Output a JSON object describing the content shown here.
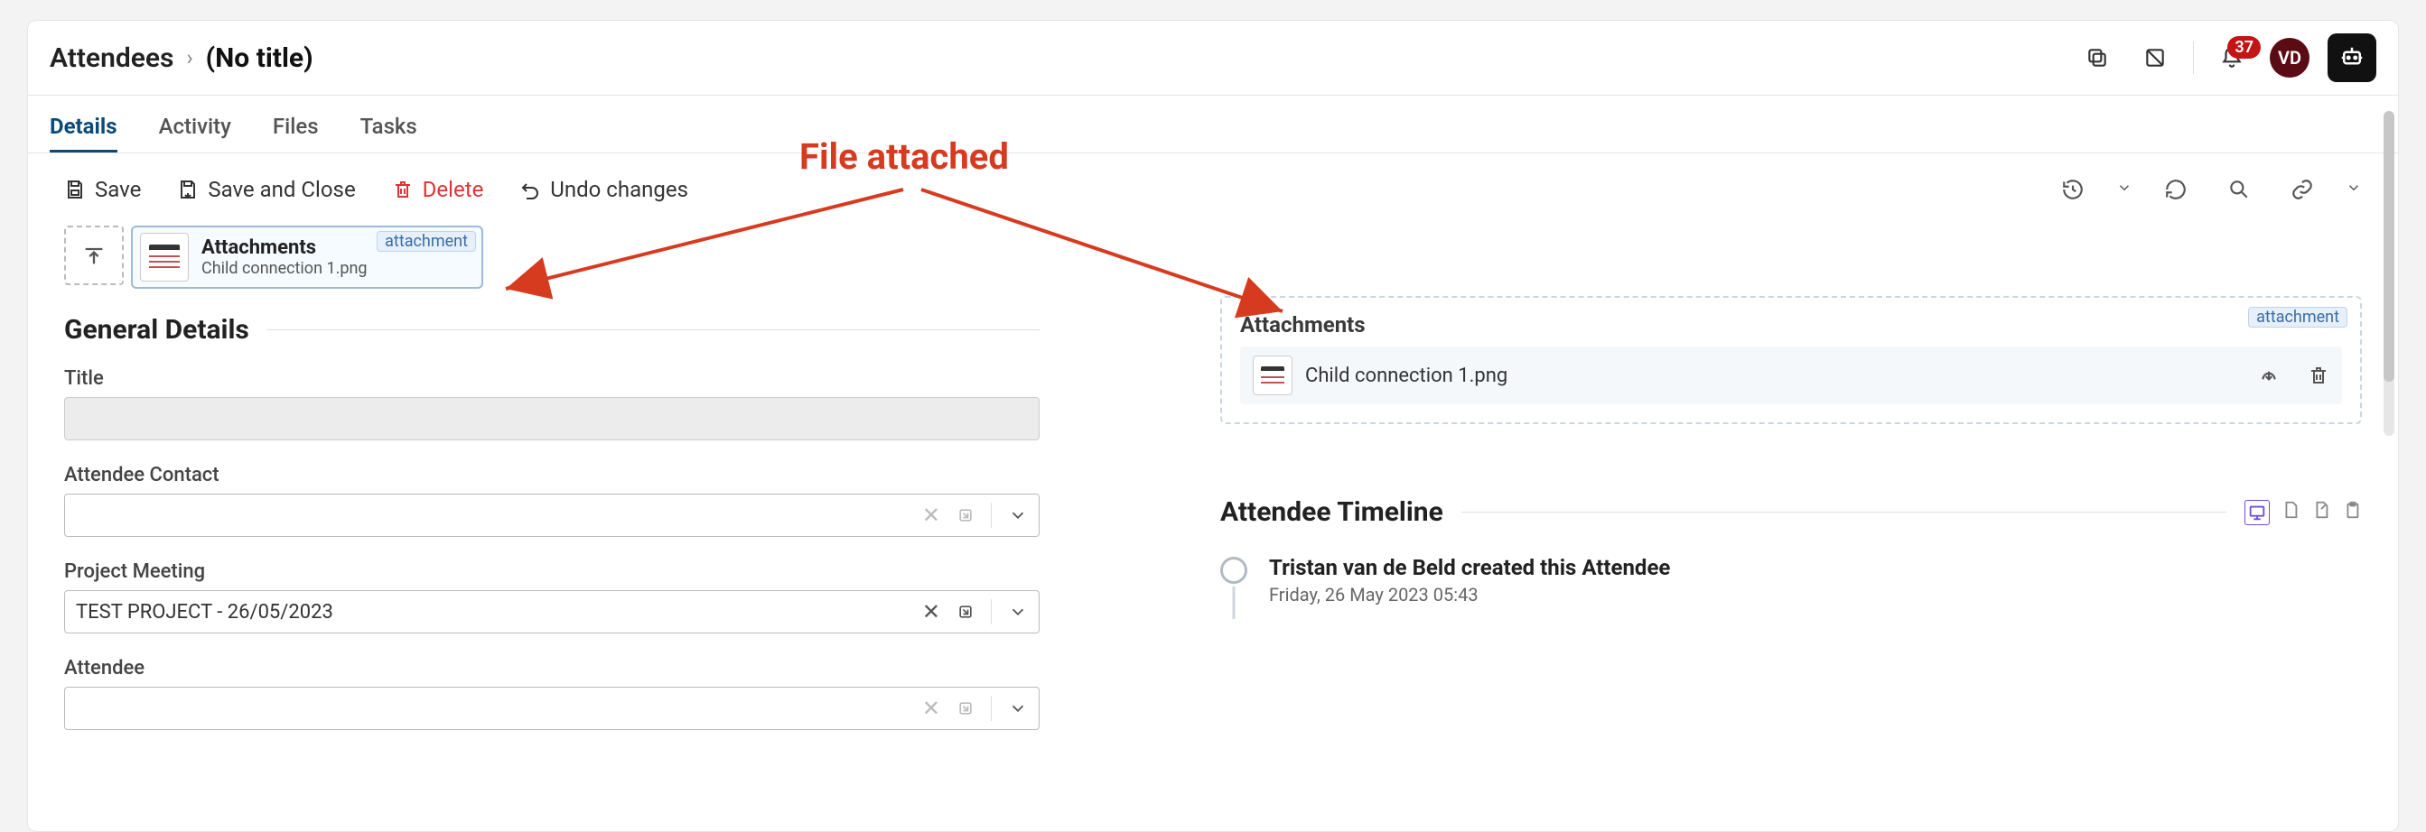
{
  "breadcrumb": {
    "root": "Attendees",
    "current": "(No title)"
  },
  "header": {
    "notification_count": "37",
    "avatar_initials": "VD"
  },
  "tabs": {
    "details": "Details",
    "activity": "Activity",
    "files": "Files",
    "tasks": "Tasks"
  },
  "toolbar": {
    "save": "Save",
    "save_close": "Save and Close",
    "delete": "Delete",
    "undo": "Undo changes"
  },
  "attach_pill": {
    "title": "Attachments",
    "filename": "Child connection 1.png",
    "tag": "attachment"
  },
  "section_general": "General Details",
  "fields": {
    "title_label": "Title",
    "title_value": "",
    "contact_label": "Attendee Contact",
    "contact_value": "",
    "meeting_label": "Project Meeting",
    "meeting_value": "TEST PROJECT - 26/05/2023",
    "attendee_label": "Attendee",
    "attendee_value": ""
  },
  "right": {
    "attachments_title": "Attachments",
    "attachments_tag": "attachment",
    "filename": "Child connection 1.png",
    "timeline_title": "Attendee Timeline",
    "timeline_item_title": "Tristan van de Beld created this Attendee",
    "timeline_item_date": "Friday, 26 May 2023 05:43"
  },
  "annotation": {
    "label": "File attached"
  }
}
